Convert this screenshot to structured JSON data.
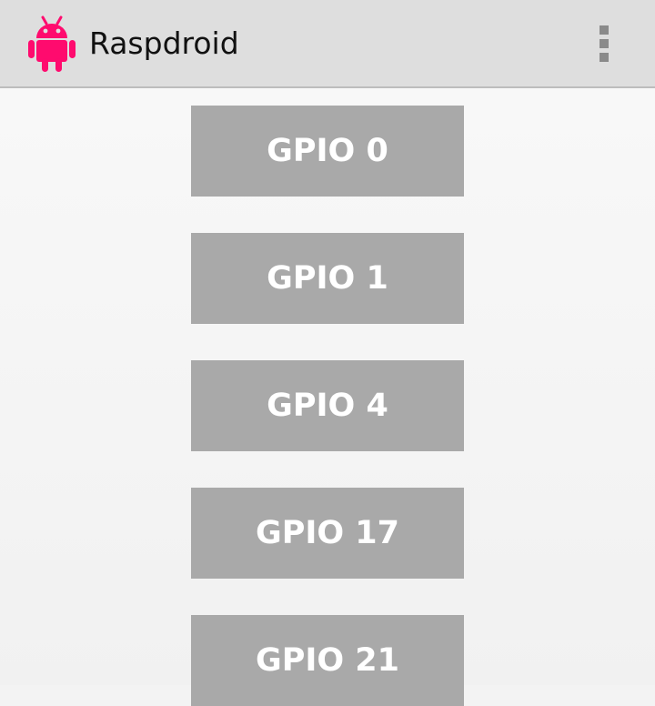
{
  "action_bar": {
    "title": "Raspdroid",
    "icon": "android-robot-icon",
    "overflow_icon": "more-vertical-icon"
  },
  "colors": {
    "action_bar_background": "#dedede",
    "app_icon": "#ff0b6e",
    "button_background": "#a9a9a9",
    "button_text": "#ffffff",
    "content_background": "#f3f3f3"
  },
  "gpio_buttons": [
    {
      "label": "GPIO 0"
    },
    {
      "label": "GPIO 1"
    },
    {
      "label": "GPIO 4"
    },
    {
      "label": "GPIO 17"
    },
    {
      "label": "GPIO 21"
    }
  ]
}
